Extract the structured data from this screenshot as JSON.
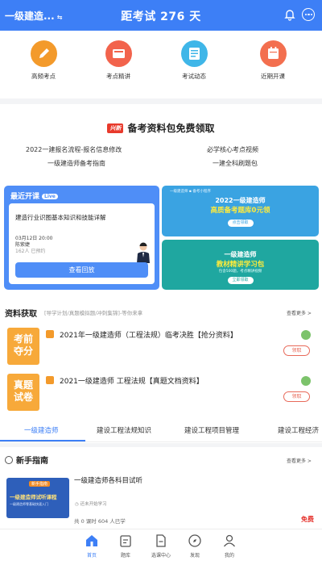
{
  "header": {
    "exam_select": "一级建造...",
    "title": "距考试 276 天"
  },
  "quick_entries": [
    {
      "label": "高频考点",
      "color": "#f39a2b",
      "icon": "pencil-icon"
    },
    {
      "label": "考点精讲",
      "color": "#f2634c",
      "icon": "video-icon"
    },
    {
      "label": "考试动态",
      "color": "#3fb6e8",
      "icon": "news-icon"
    },
    {
      "label": "近期开课",
      "color": "#f36f4f",
      "icon": "calendar-icon"
    }
  ],
  "promo": {
    "badge": "兴新",
    "title": "备考资料包免费领取",
    "links": [
      "2022一建报名流程-报名信息修改",
      "必学核心考点视频",
      "一级建造师备考指南",
      "一建全科刷题包"
    ]
  },
  "course_card": {
    "header": "最近开课",
    "live_badge": "Live",
    "course_title": "建造行业识图基本知识和技能详解",
    "time": "03月12日 20:00",
    "teacher": "陈紫婕",
    "enrolled": "162人 已预约",
    "replay_button": "查看回放"
  },
  "banners": [
    {
      "top_text": "一级建造师 ▪ 备考小程序",
      "line1": "2022一级建造师",
      "line2": "高质备考题库0元领",
      "button": "点击领取"
    },
    {
      "top_text": "",
      "line1": "一级建造师",
      "line2": "教材精讲学习包",
      "sub": "包含500题，考点精讲视频",
      "button": "立即领取"
    }
  ],
  "materials": {
    "title": "资料获取",
    "subtitle": "[导学计划/真题模拟题/冲刺集锦]-等你来拿",
    "see_more": "查看更多 >",
    "items": [
      {
        "thumb": [
          "考前",
          "夺分"
        ],
        "title": "2021年一级建造师（工程法规）临考决胜【抢分资料】",
        "claim": "领取"
      },
      {
        "thumb": [
          "真题",
          "试卷"
        ],
        "title": "2021一级建造师 工程法规【真题文档资料】",
        "claim": "领取"
      }
    ]
  },
  "tabs": [
    "一级建造师",
    "建设工程法规知识",
    "建设工程项目管理",
    "建设工程经济"
  ],
  "guide": {
    "title": "新手指南",
    "see_more": "查看更多 >",
    "thumb_badge": "新手指南",
    "thumb_title": "一级建造师试听课程",
    "thumb_sub": "一级建造师零基础快速入门",
    "course_title": "一级建造师各科目试听",
    "status": "还未开始学习",
    "meta": "共 0 课时 604 人已学",
    "price": "免费"
  },
  "bottom_nav": [
    {
      "label": "首页",
      "active": true
    },
    {
      "label": "题库",
      "active": false
    },
    {
      "label": "选课中心",
      "active": false
    },
    {
      "label": "发现",
      "active": false
    },
    {
      "label": "我的",
      "active": false
    }
  ],
  "colors": {
    "primary": "#3d7ff6",
    "accent_red": "#e5312b",
    "orange": "#f39a2b"
  }
}
